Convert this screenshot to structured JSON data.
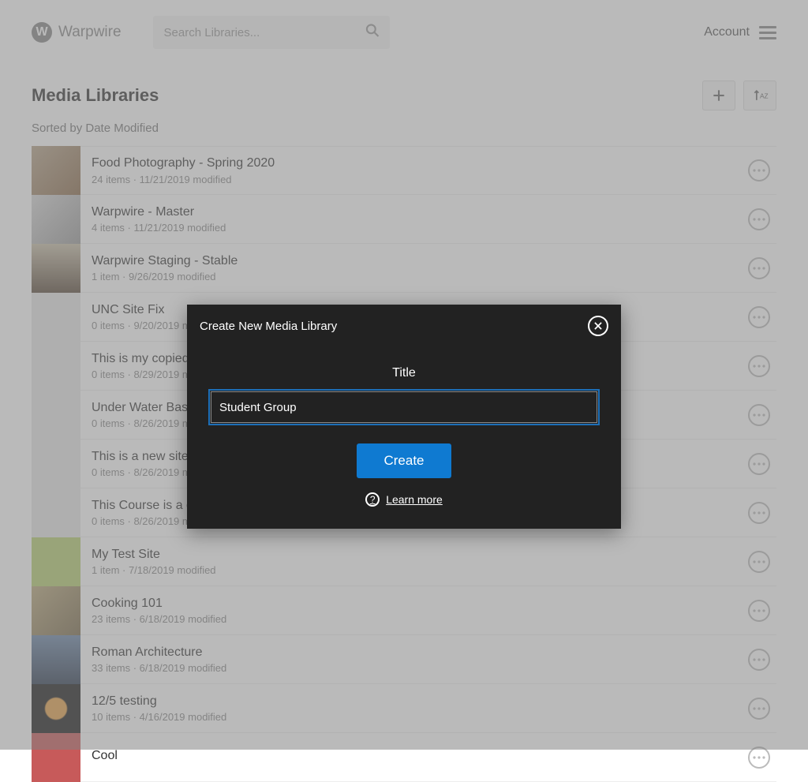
{
  "header": {
    "brand": "Warpwire",
    "search_placeholder": "Search Libraries...",
    "account_label": "Account"
  },
  "section": {
    "title": "Media Libraries",
    "sort_label": "Sorted by Date Modified"
  },
  "libraries": [
    {
      "title": "Food Photography - Spring 2020",
      "meta": "24 items · 11/21/2019 modified"
    },
    {
      "title": "Warpwire - Master",
      "meta": "4 items · 11/21/2019 modified"
    },
    {
      "title": "Warpwire Staging - Stable",
      "meta": "1 item · 9/26/2019 modified"
    },
    {
      "title": "UNC Site Fix",
      "meta": "0 items · 9/20/2019 modified"
    },
    {
      "title": "This is my copied course",
      "meta": "0 items · 8/29/2019 modified"
    },
    {
      "title": "Under Water Basket Weaving",
      "meta": "0 items · 8/26/2019 modified"
    },
    {
      "title": "This is a new site",
      "meta": "0 items · 8/26/2019 modified"
    },
    {
      "title": "This Course is a duplicate",
      "meta": "0 items · 8/26/2019 modified"
    },
    {
      "title": "My Test Site",
      "meta": "1 item · 7/18/2019 modified"
    },
    {
      "title": "Cooking 101",
      "meta": "23 items · 6/18/2019 modified"
    },
    {
      "title": "Roman Architecture",
      "meta": "33 items · 6/18/2019 modified"
    },
    {
      "title": "12/5 testing",
      "meta": "10 items · 4/16/2019 modified"
    },
    {
      "title": "Cool",
      "meta": ""
    }
  ],
  "modal": {
    "heading": "Create New Media Library",
    "field_label": "Title",
    "title_value": "Student Group",
    "create_label": "Create",
    "learn_more_label": "Learn more"
  }
}
